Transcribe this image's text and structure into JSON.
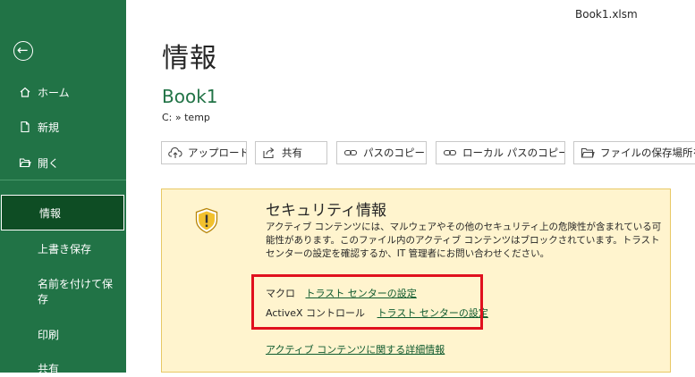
{
  "window": {
    "filename": "Book1.xlsm"
  },
  "sidebar": {
    "items": [
      {
        "label": "ホーム"
      },
      {
        "label": "新規"
      },
      {
        "label": "開く"
      },
      {
        "label": "情報"
      },
      {
        "label": "上書き保存"
      },
      {
        "label": "名前を付けて保存"
      },
      {
        "label": "印刷"
      },
      {
        "label": "共有"
      }
    ]
  },
  "main": {
    "title": "情報",
    "book_name": "Book1",
    "path": "C: » temp",
    "toolbar": [
      {
        "label": "アップロード"
      },
      {
        "label": "共有"
      },
      {
        "label": "パスのコピー"
      },
      {
        "label": "ローカル パスのコピー"
      },
      {
        "label": "ファイルの保存場所を"
      }
    ]
  },
  "security": {
    "title": "セキュリティ情報",
    "description": "アクティブ コンテンツには、マルウェアやその他のセキュリティ上の危険性が含まれている可能性があります。このファイル内のアクティブ コンテンツはブロックされています。トラスト センターの設定を確認するか、IT 管理者にお問い合わせください。",
    "macro_label": "マクロ",
    "macro_link": "トラスト センターの設定",
    "activex_label": "ActiveX コントロール",
    "activex_link": "トラスト センターの設定",
    "more_link": "アクティブ コンテンツに関する詳細情報"
  },
  "colors": {
    "sidebar_bg": "#217346",
    "sidebar_active": "#0e4d24",
    "accent_green": "#217346",
    "warning_bg": "#fff4ce",
    "highlight_red": "#e0101e"
  },
  "icons": [
    "back-arrow-icon",
    "home-icon",
    "new-file-icon",
    "open-folder-icon",
    "upload-cloud-icon",
    "share-icon",
    "link-icon",
    "folder-icon",
    "warning-shield-icon"
  ]
}
